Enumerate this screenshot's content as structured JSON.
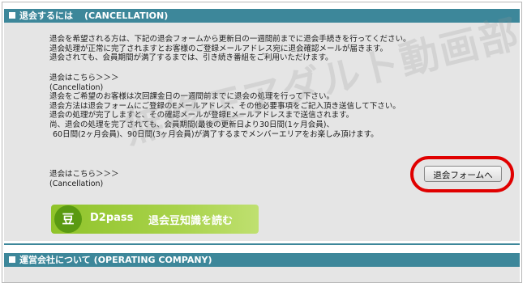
{
  "section1": {
    "title": "退会するには",
    "subtitle": "(CANCELLATION)"
  },
  "intro_lines": [
    "退会を希望される方は、下記の退会フォームから更新日の一週間前までに退会手続きを行ってください。",
    "退会処理が正常に完了されますとお客様のご登録メールアドレス宛に退会確認メールが届きます。",
    "退会されても、会員期間が満了するまでは、引き続き番組をご利用いただけます。"
  ],
  "cancel_block": [
    "退会はこちら＞＞＞",
    "(Cancellation)",
    "退会をご希望のお客様は次回課金日の一週間前までに退会の処理を行って下さい。",
    "退会方法は退会フォームにご登録のEメールアドレス、その他必要事項をご記入頂き送信して下さい。",
    "退会の処理が完了しますと、その確認メールが登録Eメールアドレスまで送信されます。",
    "尚、退会の処理を完了されても、会員期間(最後の更新日より30日間(1ヶ月会員)、",
    "60日間(2ヶ月会員)、90日間(3ヶ月会員)が満了するまでメンバーエリアをお楽しみ頂けます。"
  ],
  "cancel_link": {
    "line1": "退会はこちら＞＞＞",
    "line2": "(Cancellation)"
  },
  "form_button": "退会フォームへ",
  "watermark": "無修正アダルト動画部！",
  "banner": {
    "badge": "豆",
    "brand": "D2pass",
    "label": "退会豆知識を読む"
  },
  "section2": {
    "title": "運営会社について",
    "subtitle": "(OPERATING COMPANY)"
  },
  "colors": {
    "header": "#3d879a",
    "panel": "#e5e5e5",
    "highlight": "#e00000",
    "banner": "#8fc32a"
  }
}
